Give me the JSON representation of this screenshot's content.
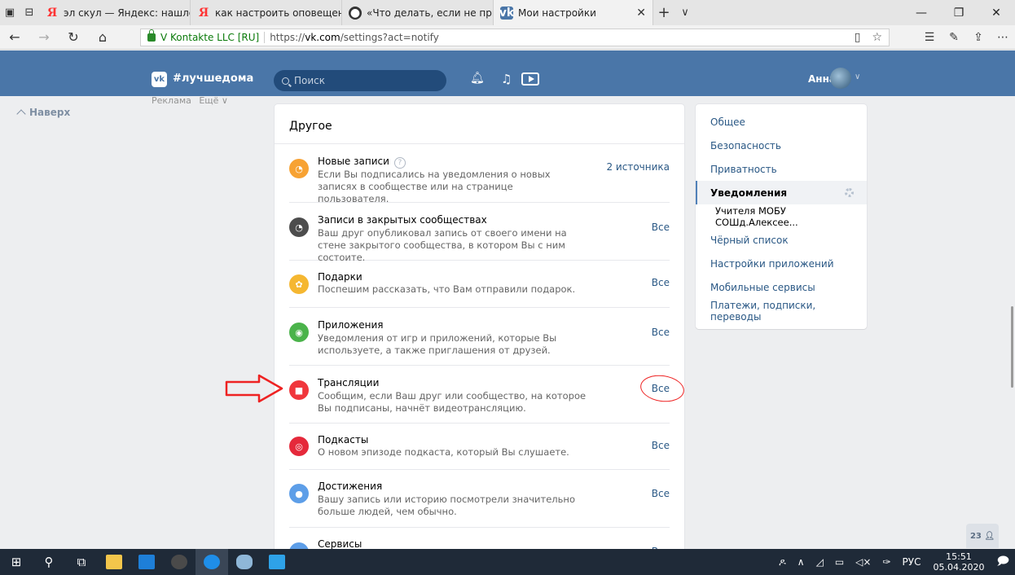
{
  "browser": {
    "tabs": [
      {
        "label": "эл скул — Яндекс: нашлось",
        "favicon": "yandex-icon"
      },
      {
        "label": "как настроить оповещени:",
        "favicon": "yandex-icon"
      },
      {
        "label": "«Что делать, если не прихс",
        "favicon": "dark-circle-icon"
      },
      {
        "label": "Мои настройки",
        "favicon": "vk-icon",
        "active": true
      }
    ],
    "new_tab": "+",
    "tab_menu": "∨",
    "certificate": "V Kontakte LLC [RU]",
    "url_prefix": "https://",
    "url_host": "vk.com",
    "url_path": "/settings?act=notify"
  },
  "vk": {
    "logo": "vk",
    "tag": "#лучшедома",
    "search_placeholder": "Поиск",
    "user_name": "Анна",
    "ads": "Реклама",
    "more": "Ещё ∨",
    "to_top": "Наверх"
  },
  "panel": {
    "title": "Другое",
    "rows": [
      {
        "title": "Новые записи",
        "desc": "Если Вы подписались на уведомления о новых записях в сообществе или на странице пользователя.",
        "value": "2 источника",
        "icon": "rss-icon",
        "color": "#f7a233",
        "help": "?"
      },
      {
        "title": "Записи в закрытых сообществах",
        "desc": "Ваш друг опубликовал запись от своего имени на стене закрытого сообщества, в котором Вы с ним состоите.",
        "value": "Все",
        "icon": "rss-icon",
        "color": "#4d4d4d"
      },
      {
        "title": "Подарки",
        "desc": "Поспешим рассказать, что Вам отправили подарок.",
        "value": "Все",
        "icon": "gift-icon",
        "color": "#f5b731"
      },
      {
        "title": "Приложения",
        "desc": "Уведомления от игр и приложений, которые Вы используете, а также приглашения от друзей.",
        "value": "Все",
        "icon": "gamepad-icon",
        "color": "#4bb34b"
      },
      {
        "title": "Трансляции",
        "desc": "Сообщим, если Ваш друг или сообщество, на которое Вы подписаны, начнёт видеотрансляцию.",
        "value": "Все",
        "icon": "video-icon",
        "color": "#f0373c"
      },
      {
        "title": "Подкасты",
        "desc": "О новом эпизоде подкаста, который Вы слушаете.",
        "value": "Все",
        "icon": "podcast-icon",
        "color": "#e5293b"
      },
      {
        "title": "Достижения",
        "desc": "Вашу запись или историю посмотрели значительно больше людей, чем обычно.",
        "value": "Все",
        "icon": "achievement-icon",
        "color": "#5d9ee8"
      },
      {
        "title": "Сервисы",
        "desc": "",
        "value": "Все",
        "icon": "services-icon",
        "color": "#5d9ee8"
      }
    ]
  },
  "menu": {
    "items": [
      {
        "label": "Общее"
      },
      {
        "label": "Безопасность"
      },
      {
        "label": "Приватность"
      },
      {
        "label": "Уведомления",
        "active": true
      },
      {
        "label": "Учителя МОБУ СОШд.Алексее...",
        "sub": true
      },
      {
        "label": "Чёрный список"
      },
      {
        "label": "Настройки приложений"
      },
      {
        "label": "Мобильные сервисы"
      },
      {
        "label": "Платежи, подписки, переводы"
      }
    ]
  },
  "counter": "23",
  "taskbar": {
    "lang": "РУС",
    "time": "15:51",
    "date": "05.04.2020"
  }
}
